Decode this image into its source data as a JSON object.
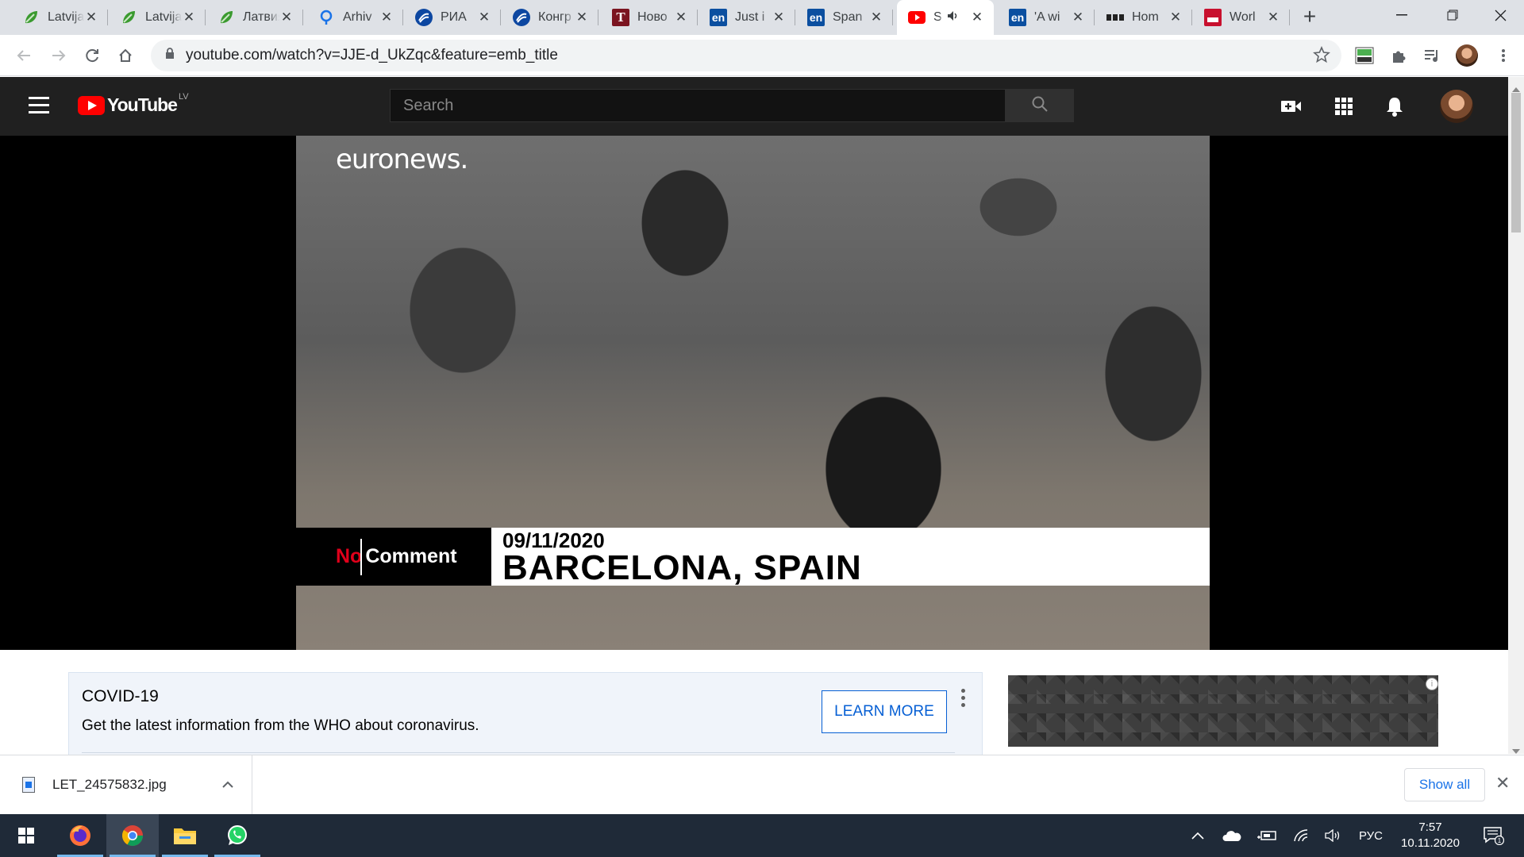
{
  "browser": {
    "tabs": [
      {
        "title": "Latvija",
        "favicon": "lsm-leaf-icon",
        "color": "#3a9a2f"
      },
      {
        "title": "Latvija",
        "favicon": "lsm-leaf-icon",
        "color": "#3a9a2f"
      },
      {
        "title": "Латвия",
        "favicon": "lsm-leaf-icon",
        "color": "#3a9a2f"
      },
      {
        "title": "Arhiv",
        "favicon": "map-pin-icon",
        "color": "#1a73e8"
      },
      {
        "title": "РИА",
        "favicon": "ria-icon",
        "color": "#0d47a1"
      },
      {
        "title": "Конгр",
        "favicon": "ria-icon",
        "color": "#0d47a1"
      },
      {
        "title": "Ново",
        "favicon": "t-icon",
        "color": "#7b1420"
      },
      {
        "title": "Just i",
        "favicon": "euronews-en-icon",
        "color": "#0b4fa0"
      },
      {
        "title": "Span",
        "favicon": "euronews-en-icon",
        "color": "#0b4fa0"
      },
      {
        "title": "S",
        "favicon": "youtube-icon",
        "color": "#ff0000",
        "active": true
      },
      {
        "title": "'A wi",
        "favicon": "euronews-en-icon",
        "color": "#0b4fa0"
      },
      {
        "title": "Hom",
        "favicon": "bbc-icon",
        "color": "#222222"
      },
      {
        "title": "Worl",
        "favicon": "sky-news-icon",
        "color": "#c8102e"
      }
    ],
    "url": "youtube.com/watch?v=JJE-d_UkZqc&feature=emb_title"
  },
  "youtube": {
    "logo_text": "YouTube",
    "region": "LV",
    "search_placeholder": "Search"
  },
  "video": {
    "brand": "euronews.",
    "show_no": "No",
    "show_comment": "Comment",
    "date": "09/11/2020",
    "location": "BARCELONA, SPAIN"
  },
  "covid_banner": {
    "title": "COVID-19",
    "text": "Get the latest information from the WHO about coronavirus.",
    "button": "LEARN MORE"
  },
  "downloads": {
    "file": "LET_24575832.jpg",
    "show_all": "Show all"
  },
  "taskbar": {
    "language": "РУС",
    "time": "7:57",
    "date": "10.11.2020",
    "notifications": "1"
  },
  "colors": {
    "youtube_red": "#ff0000",
    "link_blue": "#065fd4",
    "taskbar": "#1f2a38"
  }
}
